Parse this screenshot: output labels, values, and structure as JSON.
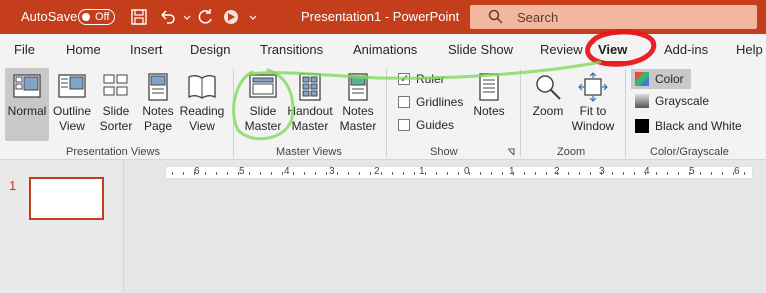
{
  "titlebar": {
    "autosave_label": "AutoSave",
    "autosave_state": "Off",
    "title": "Presentation1 - PowerPoint",
    "search_placeholder": "Search",
    "icons": [
      "save-icon",
      "undo-icon",
      "redo-icon",
      "present-icon"
    ]
  },
  "tabs": [
    {
      "label": "File"
    },
    {
      "label": "Home"
    },
    {
      "label": "Insert"
    },
    {
      "label": "Design"
    },
    {
      "label": "Transitions"
    },
    {
      "label": "Animations"
    },
    {
      "label": "Slide Show"
    },
    {
      "label": "Review"
    },
    {
      "label": "View",
      "active": true
    },
    {
      "label": "Add-ins"
    },
    {
      "label": "Help"
    }
  ],
  "ribbon": {
    "presentation_views": {
      "label": "Presentation Views",
      "items": [
        {
          "line1": "Normal",
          "line2": "",
          "selected": true
        },
        {
          "line1": "Outline",
          "line2": "View"
        },
        {
          "line1": "Slide",
          "line2": "Sorter"
        },
        {
          "line1": "Notes",
          "line2": "Page"
        },
        {
          "line1": "Reading",
          "line2": "View"
        }
      ]
    },
    "master_views": {
      "label": "Master Views",
      "items": [
        {
          "line1": "Slide",
          "line2": "Master"
        },
        {
          "line1": "Handout",
          "line2": "Master"
        },
        {
          "line1": "Notes",
          "line2": "Master"
        }
      ]
    },
    "show": {
      "label": "Show",
      "checkboxes": [
        {
          "label": "Ruler",
          "checked": true
        },
        {
          "label": "Gridlines",
          "checked": false
        },
        {
          "label": "Guides",
          "checked": false
        }
      ],
      "notes_label": "Notes"
    },
    "zoom": {
      "label": "Zoom",
      "zoom_label": "Zoom",
      "fit_line1": "Fit to",
      "fit_line2": "Window"
    },
    "color_grayscale": {
      "label": "Color/Grayscale",
      "items": [
        {
          "label": "Color",
          "selected": true
        },
        {
          "label": "Grayscale"
        },
        {
          "label": "Black and White"
        }
      ]
    }
  },
  "thumbnails": {
    "slide_number": "1"
  },
  "ruler": {
    "labels": [
      "6",
      "5",
      "4",
      "3",
      "2",
      "1",
      "0",
      "1",
      "2",
      "3",
      "4",
      "5",
      "6"
    ]
  },
  "colors": {
    "accent": "#c43e1c",
    "annotation_red": "#e8141c",
    "annotation_green": "#7fd957"
  }
}
